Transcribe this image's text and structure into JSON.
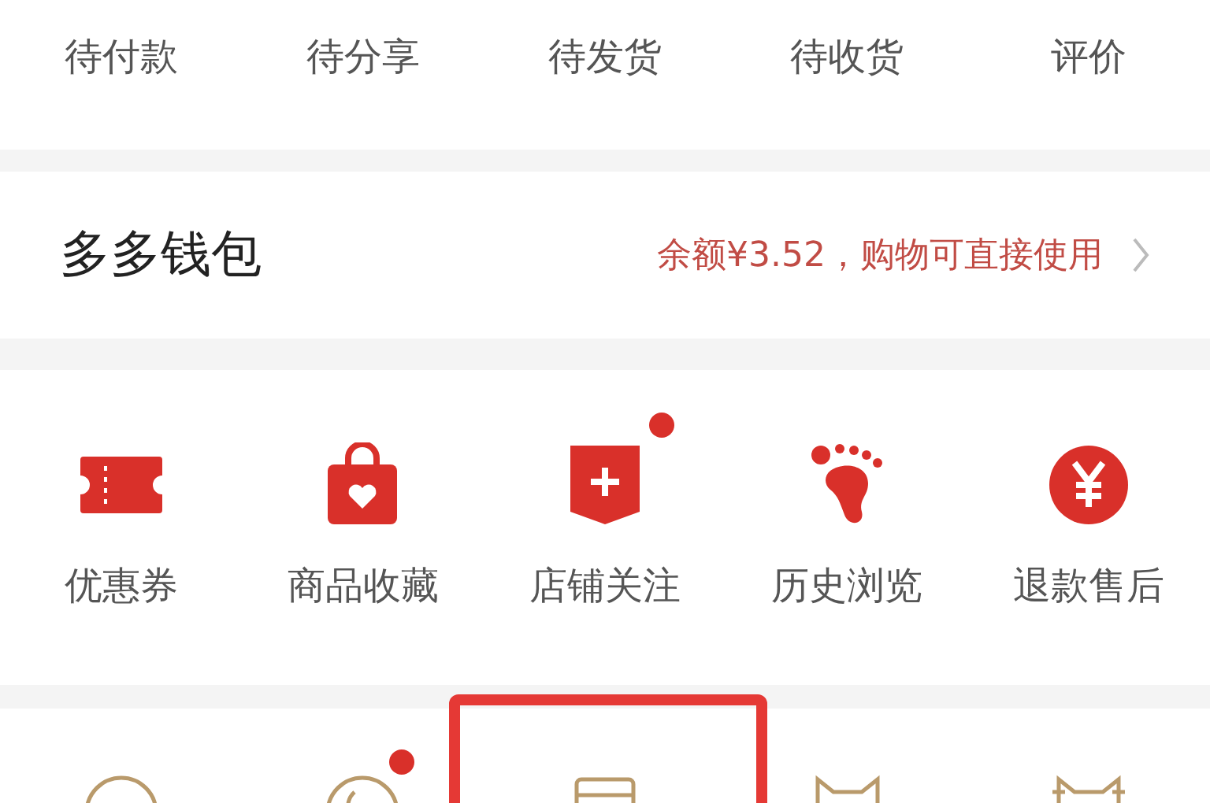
{
  "order_tabs": [
    {
      "label": "待付款"
    },
    {
      "label": "待分享"
    },
    {
      "label": "待发货"
    },
    {
      "label": "待收货"
    },
    {
      "label": "评价"
    }
  ],
  "wallet": {
    "title": "多多钱包",
    "balance_text": "余额¥3.52，购物可直接使用"
  },
  "shortcuts": [
    {
      "kind": "ticket",
      "label": "优惠券",
      "badge": false
    },
    {
      "kind": "bag",
      "label": "商品收藏",
      "badge": false
    },
    {
      "kind": "shop",
      "label": "店铺关注",
      "badge": true
    },
    {
      "kind": "foot",
      "label": "历史浏览",
      "badge": false
    },
    {
      "kind": "yen",
      "label": "退款售后",
      "badge": false
    }
  ],
  "more_icons": [
    {
      "kind": "circle",
      "badge": false
    },
    {
      "kind": "coin",
      "badge": true
    },
    {
      "kind": "box",
      "badge": false
    },
    {
      "kind": "cat",
      "badge": false
    },
    {
      "kind": "cat2",
      "badge": false
    }
  ]
}
